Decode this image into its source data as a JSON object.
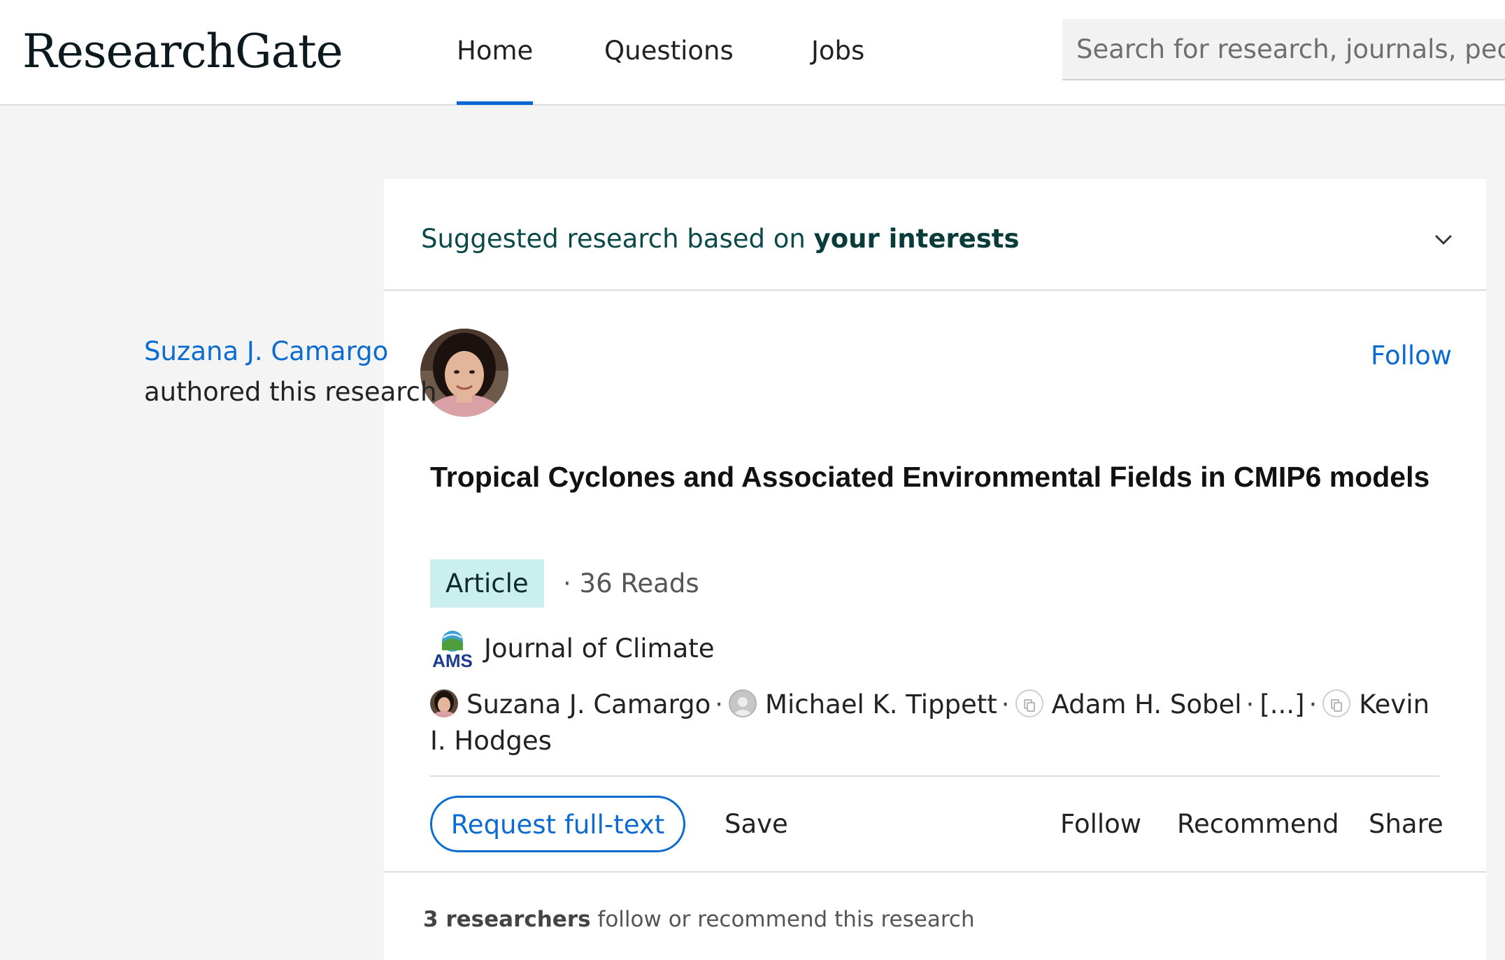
{
  "header": {
    "logo": "ResearchGate",
    "tabs": [
      {
        "label": "Home",
        "active": true
      },
      {
        "label": "Questions",
        "active": false
      },
      {
        "label": "Jobs",
        "active": false
      }
    ],
    "search_placeholder": "Search for research, journals, people"
  },
  "feed": {
    "header_prefix": "Suggested research based on ",
    "header_emphasis": "your interests",
    "author_name": "Suzana J. Camargo",
    "author_action": "authored this research",
    "follow_label": "Follow",
    "title": "Tropical Cyclones and Associated Environmental Fields in CMIP6 models",
    "type_badge": "Article",
    "reads": "· 36 Reads",
    "journal_logo_text": "AMS",
    "journal": "Journal of Climate",
    "authors": [
      "Suzana J. Camargo",
      "Michael K. Tippett",
      "Adam H. Sobel",
      "[...]",
      "Kevin I. Hodges"
    ],
    "separator": "·",
    "actions": {
      "request": "Request full-text",
      "save": "Save",
      "follow": "Follow",
      "recommend": "Recommend",
      "share": "Share"
    },
    "footer_bold": "3 researchers",
    "footer_rest": " follow or recommend this research"
  },
  "colors": {
    "link_blue": "#0b6bd0",
    "header_green": "#0b4a48",
    "badge_bg": "#cbeeee",
    "active_tab_underline": "#0066d6"
  }
}
